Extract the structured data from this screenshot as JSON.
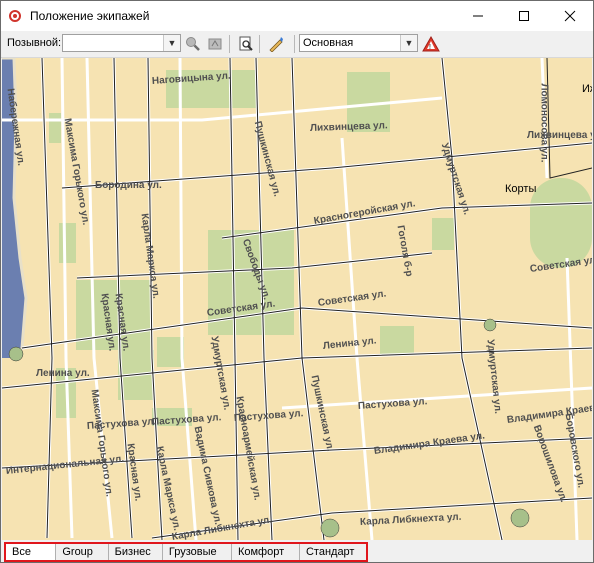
{
  "window": {
    "title": "Положение экипажей"
  },
  "toolbar": {
    "callsign_label": "Позывной:",
    "callsign_value": "",
    "map_layer_value": "Основная",
    "icons": [
      "zoom-in-icon",
      "zoom-out-icon",
      "print-preview-icon",
      "edit-map-icon",
      "route-warning-icon"
    ]
  },
  "map": {
    "streets": [
      "Наговицына ул.",
      "Пушкинская ул.",
      "Лихвинцева ул.",
      "Удмуртская ул.",
      "Ломоносова ул.",
      "Лихвинцева ул.",
      "Красногеройская ул.",
      "Корты",
      "Гоголя б-р",
      "Советская ул.",
      "Советская ул.",
      "Свободы ул.",
      "Советская ул.",
      "Ленина ул.",
      "Ленина ул.",
      "Удмуртская ул.",
      "Красная ул.",
      "Карла Маркса ул.",
      "Максима Горького ул.",
      "Бородина ул.",
      "Пастухова ул.",
      "Пастухова ул.",
      "Пастухова ул.",
      "Пастухова ул.",
      "Пушкинская ул.",
      "Владимира Краева ул.",
      "Владимира Краева ул.",
      "Интернациональная ул.",
      "Карла Либкнехта ул.",
      "Карла Либкнехта ул.",
      "Вадима Сивкова ул.",
      "Карла Маркса ул.",
      "Красная ул.",
      "Максима Горького ул.",
      "Набережная ул.",
      "Ворошилова ул.",
      "Удмуртская ул.",
      "Ижевск",
      "Боровского ул.",
      "Красноармейская ул.",
      "Красная ул."
    ]
  },
  "tabs": [
    "Все",
    "Group",
    "Бизнес",
    "Грузовые",
    "Комфорт",
    "Стандарт"
  ],
  "colors": {
    "map_bg": "#f6e3b2",
    "park": "#c9d9a0",
    "water": "#6b7fb0",
    "road": "#ffffff",
    "tabs_highlight": "#e0161c"
  }
}
